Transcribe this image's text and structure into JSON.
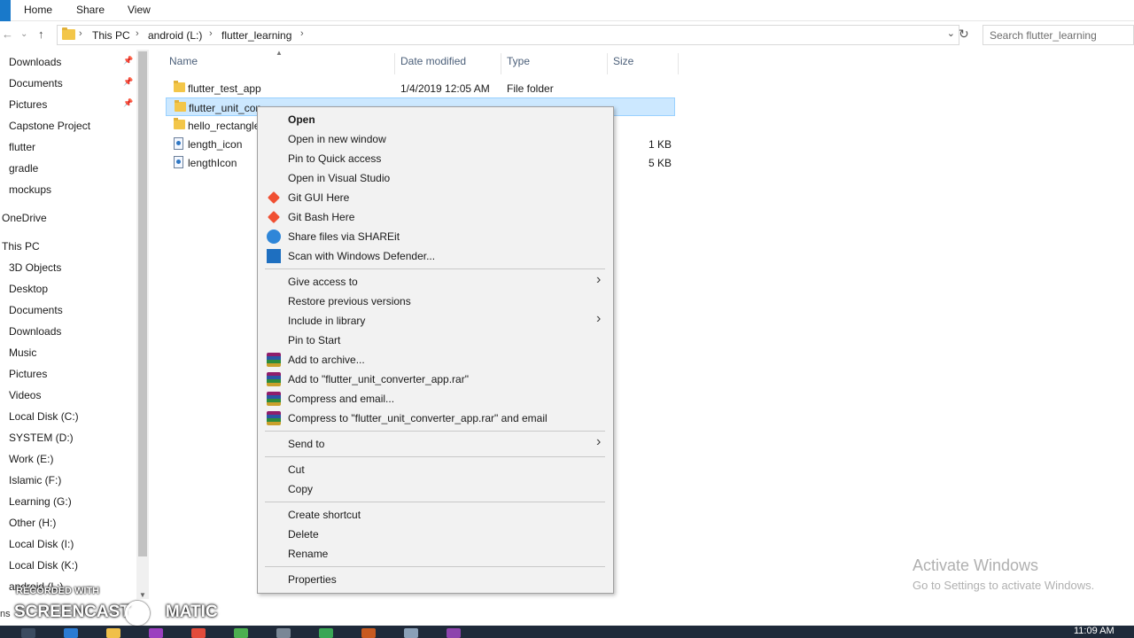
{
  "ribbon": {
    "tabs": [
      "Home",
      "Share",
      "View"
    ]
  },
  "address": {
    "crumbs": [
      "This PC",
      "android (L:)",
      "flutter_learning"
    ],
    "search_placeholder": "Search flutter_learning"
  },
  "sidebar": {
    "items": [
      {
        "label": "Downloads",
        "pinned": true
      },
      {
        "label": "Documents",
        "pinned": true
      },
      {
        "label": "Pictures",
        "pinned": true
      },
      {
        "label": "Capstone Project"
      },
      {
        "label": "flutter"
      },
      {
        "label": "gradle"
      },
      {
        "label": "mockups"
      },
      {
        "label": "OneDrive"
      },
      {
        "label": "This PC"
      },
      {
        "label": "3D Objects"
      },
      {
        "label": "Desktop"
      },
      {
        "label": "Documents"
      },
      {
        "label": "Downloads"
      },
      {
        "label": "Music"
      },
      {
        "label": "Pictures"
      },
      {
        "label": "Videos"
      },
      {
        "label": "Local Disk (C:)"
      },
      {
        "label": "SYSTEM (D:)"
      },
      {
        "label": "Work (E:)"
      },
      {
        "label": "Islamic (F:)"
      },
      {
        "label": "Learning (G:)"
      },
      {
        "label": "Other (H:)"
      },
      {
        "label": "Local Disk (I:)"
      },
      {
        "label": "Local Disk (K:)"
      },
      {
        "label": "android (L:)"
      }
    ]
  },
  "columns": {
    "name": "Name",
    "date": "Date modified",
    "type": "Type",
    "size": "Size"
  },
  "files": [
    {
      "name": "flutter_test_app",
      "date": "1/4/2019 12:05 AM",
      "type": "File folder",
      "size": "",
      "kind": "folder"
    },
    {
      "name": "flutter_unit_con",
      "date": "",
      "type": "",
      "size": "",
      "kind": "folder",
      "selected": true
    },
    {
      "name": "hello_rectangle",
      "date": "",
      "type": "",
      "size": "",
      "kind": "folder"
    },
    {
      "name": "length_icon",
      "date": "",
      "type": "",
      "size": "1 KB",
      "kind": "file"
    },
    {
      "name": "lengthIcon",
      "date": "",
      "type": "",
      "size": "5 KB",
      "kind": "file"
    }
  ],
  "context_menu": {
    "groups": [
      [
        {
          "label": "Open",
          "bold": true
        },
        {
          "label": "Open in new window"
        },
        {
          "label": "Pin to Quick access"
        },
        {
          "label": "Open in Visual Studio"
        },
        {
          "label": "Git GUI Here",
          "icon": "git-icon"
        },
        {
          "label": "Git Bash Here",
          "icon": "git-icon"
        },
        {
          "label": "Share files via SHAREit",
          "icon": "shareit-icon"
        },
        {
          "label": "Scan with Windows Defender...",
          "icon": "defender-icon"
        }
      ],
      [
        {
          "label": "Give access to",
          "submenu": true
        },
        {
          "label": "Restore previous versions"
        },
        {
          "label": "Include in library",
          "submenu": true
        },
        {
          "label": "Pin to Start"
        },
        {
          "label": "Add to archive...",
          "icon": "winrar-icon"
        },
        {
          "label": "Add to \"flutter_unit_converter_app.rar\"",
          "icon": "winrar-icon"
        },
        {
          "label": "Compress and email...",
          "icon": "winrar-icon"
        },
        {
          "label": "Compress to \"flutter_unit_converter_app.rar\" and email",
          "icon": "winrar-icon"
        }
      ],
      [
        {
          "label": "Send to",
          "submenu": true
        }
      ],
      [
        {
          "label": "Cut"
        },
        {
          "label": "Copy"
        }
      ],
      [
        {
          "label": "Create shortcut"
        },
        {
          "label": "Delete"
        },
        {
          "label": "Rename"
        }
      ],
      [
        {
          "label": "Properties"
        }
      ]
    ]
  },
  "watermark": {
    "activate_title": "Activate Windows",
    "activate_sub": "Go to Settings to activate Windows.",
    "recorded_with": "RECORDED WITH",
    "screencast": "SCREENCAST",
    "matic": "MATIC"
  },
  "status": {
    "left": "ns"
  },
  "taskbar": {
    "clock": "11:09 AM"
  }
}
